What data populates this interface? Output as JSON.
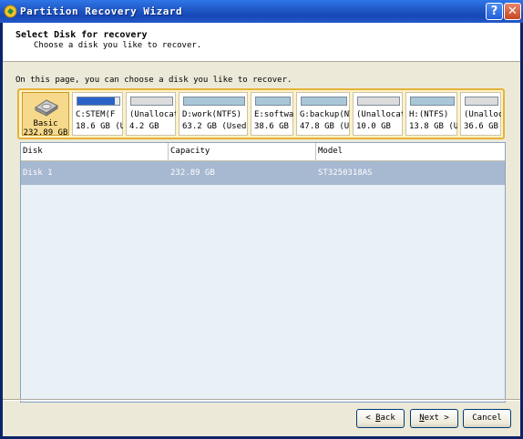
{
  "window": {
    "title": "Partition Recovery Wizard",
    "help_label": "?",
    "close_label": "✕"
  },
  "header": {
    "title": "Select Disk for recovery",
    "subtitle": "Choose a disk you like to recover."
  },
  "instruction": "On this page, you can choose a disk you like to recover.",
  "disk_map": {
    "basic": {
      "label": "Basic",
      "size": "232.89 GB"
    },
    "partitions": [
      {
        "name": "C:STEM(F",
        "size": "18.6 GB (U",
        "used": 0.9
      },
      {
        "name": "(Unallocat",
        "size": "4.2 GB",
        "used": 0
      },
      {
        "name": "D:work(NTFS)",
        "size": "63.2 GB (Used:",
        "used": 0.0
      },
      {
        "name": "E:softwa",
        "size": "38.6 GB",
        "used": 0.0
      },
      {
        "name": "G:backup(NT",
        "size": "47.8 GB (U",
        "used": 0.0
      },
      {
        "name": "(Unallocat",
        "size": "10.0 GB",
        "used": 0
      },
      {
        "name": "H:(NTFS)",
        "size": "13.8 GB (U",
        "used": 0.0
      },
      {
        "name": "(Unalloc",
        "size": "36.6 GB",
        "used": 0
      }
    ]
  },
  "table": {
    "columns": [
      "Disk",
      "Capacity",
      "Model"
    ],
    "rows": [
      {
        "disk": "Disk 1",
        "capacity": "232.89 GB",
        "model": "ST3250318AS"
      }
    ]
  },
  "buttons": {
    "back_pre": "< ",
    "back_u": "B",
    "back_post": "ack",
    "next_u": "N",
    "next_post": "ext >",
    "cancel": "Cancel"
  }
}
